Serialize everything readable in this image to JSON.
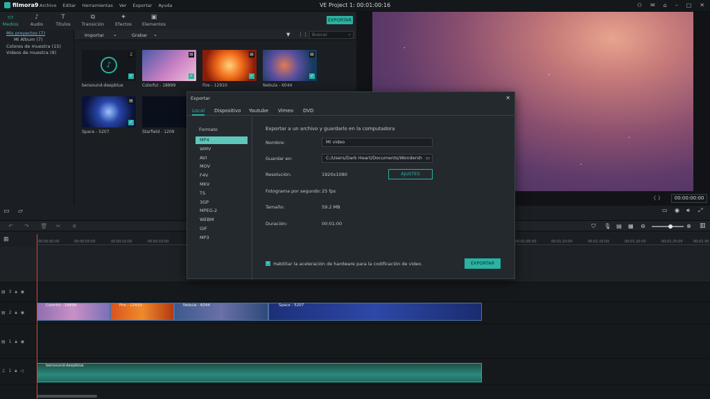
{
  "app": {
    "logo": "filmora9",
    "title": "VE Project 1:  00:01:00:16"
  },
  "menu": [
    "Archivo",
    "Editar",
    "Herramientas",
    "Ver",
    "Exportar",
    "Ayuda"
  ],
  "tabs": [
    "Medios",
    "Audio",
    "Títulos",
    "Transición",
    "Efectos",
    "Elementos"
  ],
  "top_export": "EXPORTAR",
  "tree": [
    "Mis proyectos (7)",
    "Mi Album (7)",
    "Colores de muestra (15)",
    "Videos de muestra (9)"
  ],
  "libbar": {
    "import": "Importar",
    "record": "Grabar",
    "search_placeholder": "Buscar"
  },
  "media": [
    {
      "label": "bensound-deepblue"
    },
    {
      "label": "Colorful - 18899"
    },
    {
      "label": "Fire - 12910"
    },
    {
      "label": "Nebula - 6044"
    },
    {
      "label": "Space - 5207"
    },
    {
      "label": "Starfield - 1209"
    }
  ],
  "preview": {
    "timecode": "00:00:00:00"
  },
  "ruler": [
    "00:00:00:00",
    "00:00:05:00",
    "00:00:10:00",
    "00:00:15:00",
    "00:01:05:00",
    "00:01:10:00",
    "00:01:15:00",
    "00:01:20:00",
    "00:01:25:00",
    "00:01:30"
  ],
  "clips": {
    "c1": "Colorful - 18899",
    "c2": "Fire - 12910",
    "c3": "Nebula - 6044",
    "c4": "Space - 5207",
    "audio": "bensound-deepblue"
  },
  "dialog": {
    "title": "Exportar",
    "tabs": [
      "Local",
      "Dispositivo",
      "Youtube",
      "Vimeo",
      "DVD"
    ],
    "format_heading": "Formato",
    "formats": [
      "MP4",
      "WMV",
      "AVI",
      "MOV",
      "F4V",
      "MKV",
      "TS",
      "3GP",
      "MPEG-2",
      "WEBM",
      "GIF",
      "MP3"
    ],
    "heading": "Exportar a un archivo y guardarlo en la computadora",
    "name_label": "Nombre:",
    "name_value": "Mi video",
    "save_label": "Guardar en:",
    "save_value": "C:/Users/Dark Heart/Documents/Wondersh",
    "res_label": "Resolución:",
    "res_value": "1920x1080",
    "settings": "AJUSTES",
    "fps_label": "Fotograma por segundo:",
    "fps_value": "25 fps",
    "size_label": "Tamaño:",
    "size_value": "59.2 MB",
    "dur_label": "Duración:",
    "dur_value": "00:01:00",
    "hw_label": "Habilitar la aceleración de hardware para la codificación de video.",
    "export": "EXPORTAR"
  },
  "tracks": [
    "3",
    "2",
    "1",
    "1"
  ]
}
